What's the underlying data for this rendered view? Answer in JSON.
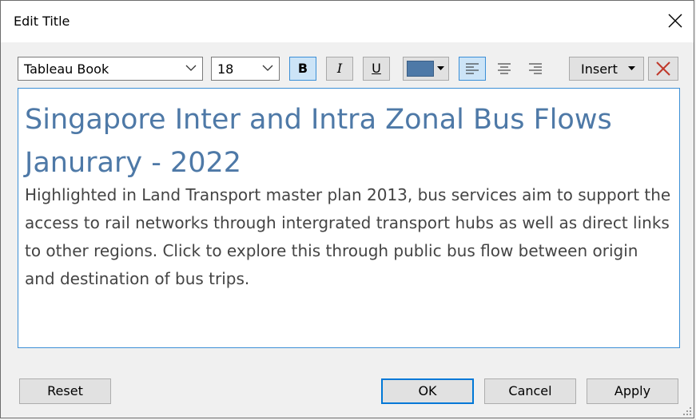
{
  "dialog": {
    "title": "Edit Title"
  },
  "toolbar": {
    "font_family": "Tableau Book",
    "font_size": "18",
    "bold_label": "B",
    "italic_label": "I",
    "underline_label": "U",
    "font_color": "#4e79a7",
    "insert_label": "Insert",
    "bold_active": true,
    "align_left_active": true
  },
  "editor": {
    "heading_lines": [
      "Singapore Inter and Intra  Zonal Bus Flows",
      "Janurary - 2022"
    ],
    "body": "Highlighted in Land Transport master plan 2013, bus services aim to support the access to rail networks through intergrated transport hubs as well as direct links to other regions.   Click to explore this through public bus flow between origin and destination of bus trips.",
    "heading_color": "#4e79a7",
    "body_color": "#444444"
  },
  "buttons": {
    "reset": "Reset",
    "ok": "OK",
    "cancel": "Cancel",
    "apply": "Apply"
  }
}
